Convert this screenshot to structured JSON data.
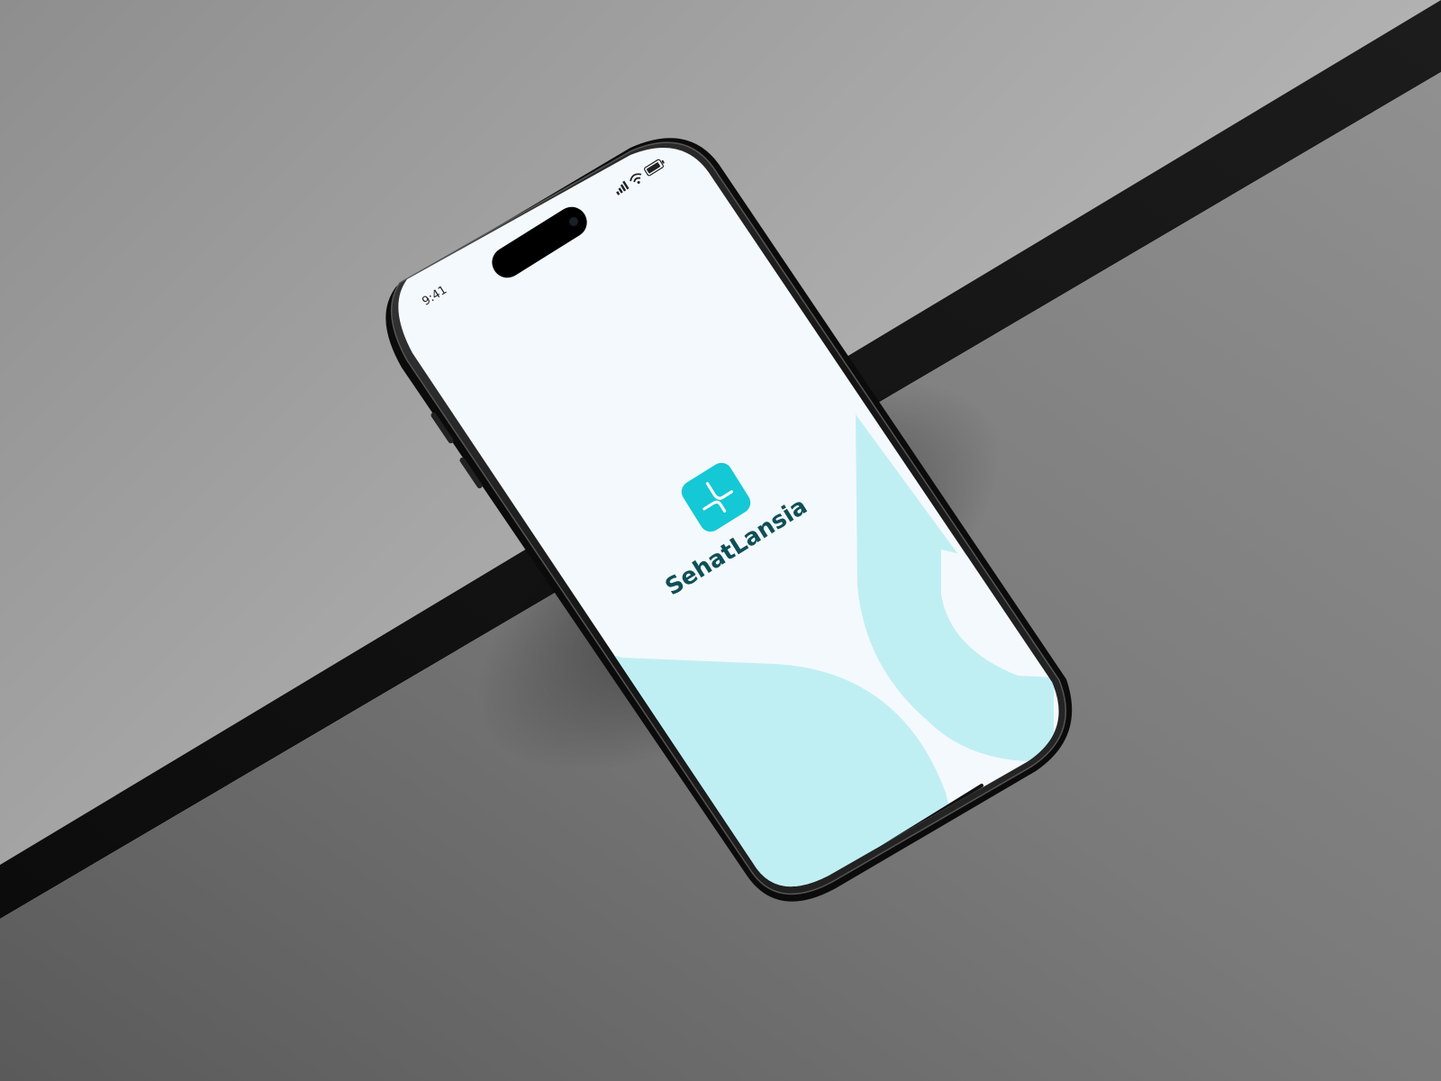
{
  "status_bar": {
    "time": "9:41",
    "signal_icon": "cellular-signal-icon",
    "wifi_icon": "wifi-icon",
    "battery_icon": "battery-icon"
  },
  "app": {
    "name": "SehatLansia",
    "logo_icon": "sehatlansia-cross-logo-icon"
  },
  "colors": {
    "brand_teal": "#14c8d6",
    "wordmark": "#0f4f57",
    "accent_wave": "#c0eff3",
    "screen_bg": "#f4f9fd",
    "phone_frame": "#1a1a1a"
  }
}
